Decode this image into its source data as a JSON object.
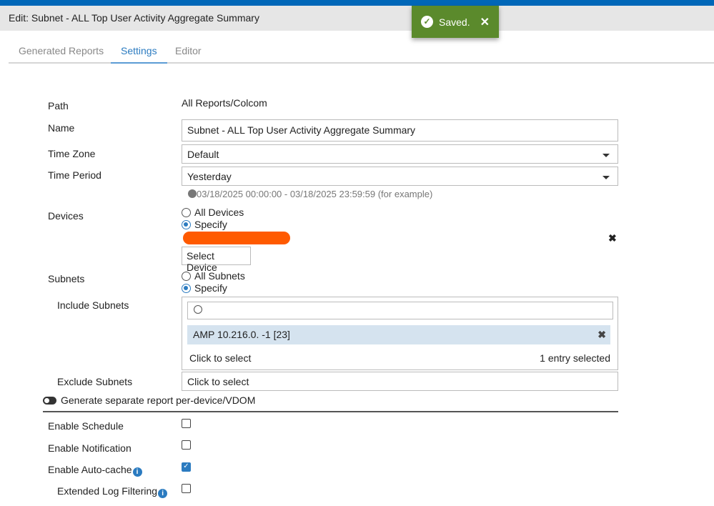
{
  "window": {
    "title": "Edit: Subnet - ALL Top User Activity Aggregate Summary"
  },
  "toast": {
    "text": "Saved."
  },
  "tabs": [
    {
      "label": "Generated Reports"
    },
    {
      "label": "Settings"
    },
    {
      "label": "Editor"
    }
  ],
  "form": {
    "path_label": "Path",
    "path_value": "All Reports/Colcom",
    "name_label": "Name",
    "name_value": "Subnet - ALL Top User Activity Aggregate Summary",
    "timezone_label": "Time Zone",
    "timezone_value": "Default",
    "period_label": "Time Period",
    "period_value": "Yesterday",
    "period_example": "03/18/2025 00:00:00 - 03/18/2025 23:59:59 (for example)",
    "devices_label": "Devices",
    "devices_all": "All Devices",
    "devices_specify": "Specify",
    "select_device": "Select Device",
    "subnets_label": "Subnets",
    "subnets_all": "All Subnets",
    "subnets_specify": "Specify",
    "include_label": "Include Subnets",
    "include_item": "AMP 10.216.0. -1 [23]",
    "click_to_select": "Click to select",
    "entries_selected": "1 entry selected",
    "exclude_label": "Exclude Subnets",
    "exclude_value": "Click to select",
    "per_device_label": "Generate separate report per-device/VDOM",
    "schedule_label": "Enable Schedule",
    "notification_label": "Enable Notification",
    "autocache_label": "Enable Auto-cache",
    "extended_label": "Extended Log Filtering"
  }
}
